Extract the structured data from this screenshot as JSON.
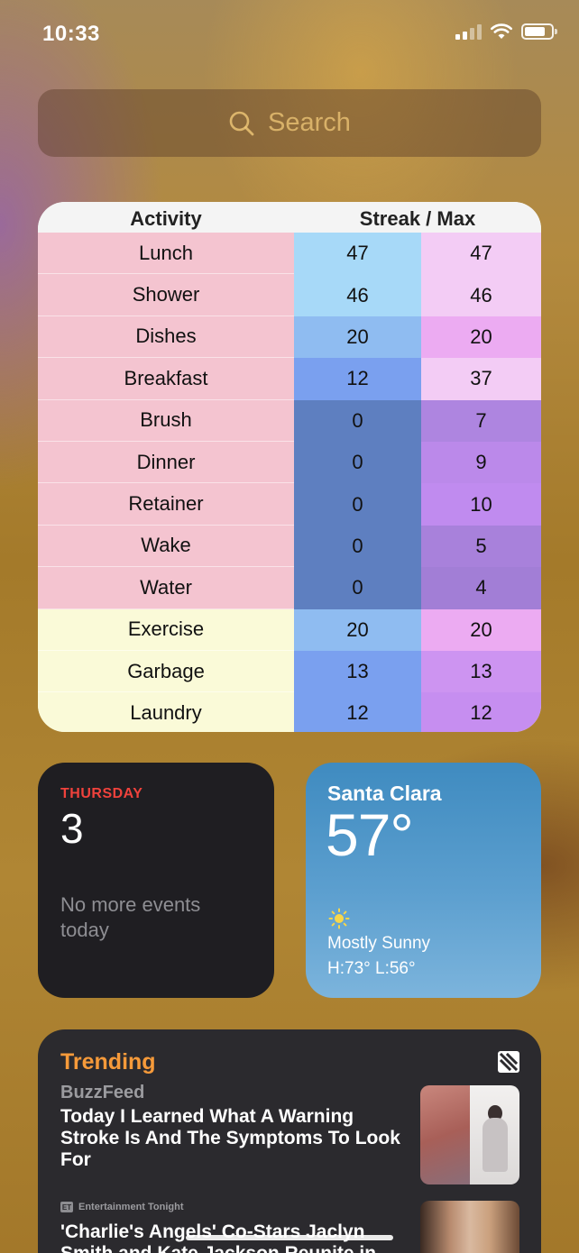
{
  "status_bar": {
    "time": "10:33"
  },
  "search": {
    "label": "Search"
  },
  "activity_widget": {
    "header_activity": "Activity",
    "header_streak_max": "Streak / Max",
    "rows": [
      {
        "activity": "Lunch",
        "streak": "47",
        "max": "47",
        "name_color": "#f4c4d0",
        "streak_color": "#a7d9f8",
        "max_color": "#f3ccf5"
      },
      {
        "activity": "Shower",
        "streak": "46",
        "max": "46",
        "name_color": "#f4c4d0",
        "streak_color": "#a7d9f8",
        "max_color": "#f3ccf5"
      },
      {
        "activity": "Dishes",
        "streak": "20",
        "max": "20",
        "name_color": "#f4c4d0",
        "streak_color": "#8fbcf1",
        "max_color": "#ecabf2"
      },
      {
        "activity": "Breakfast",
        "streak": "12",
        "max": "37",
        "name_color": "#f4c4d0",
        "streak_color": "#7aa0ef",
        "max_color": "#f3ccf5"
      },
      {
        "activity": "Brush",
        "streak": "0",
        "max": "7",
        "name_color": "#f4c4d0",
        "streak_color": "#5e7fc0",
        "max_color": "#ae85e0"
      },
      {
        "activity": "Dinner",
        "streak": "0",
        "max": "9",
        "name_color": "#f4c4d0",
        "streak_color": "#5e7fc0",
        "max_color": "#bb89ea"
      },
      {
        "activity": "Retainer",
        "streak": "0",
        "max": "10",
        "name_color": "#f4c4d0",
        "streak_color": "#5e7fc0",
        "max_color": "#c08bef"
      },
      {
        "activity": "Wake",
        "streak": "0",
        "max": "5",
        "name_color": "#f4c4d0",
        "streak_color": "#5e7fc0",
        "max_color": "#a881db"
      },
      {
        "activity": "Water",
        "streak": "0",
        "max": "4",
        "name_color": "#f4c4d0",
        "streak_color": "#5e7fc0",
        "max_color": "#a27ed6"
      },
      {
        "activity": "Exercise",
        "streak": "20",
        "max": "20",
        "name_color": "#fafad8",
        "streak_color": "#8fbcf1",
        "max_color": "#ecabf2"
      },
      {
        "activity": "Garbage",
        "streak": "13",
        "max": "13",
        "name_color": "#fafad8",
        "streak_color": "#7aa0ef",
        "max_color": "#cd94f1"
      },
      {
        "activity": "Laundry",
        "streak": "12",
        "max": "12",
        "name_color": "#fafad8",
        "streak_color": "#7aa0ef",
        "max_color": "#c68ef0"
      }
    ]
  },
  "calendar_widget": {
    "day": "THURSDAY",
    "date": "3",
    "events": "No more events today"
  },
  "weather_widget": {
    "city": "Santa Clara",
    "temperature": "57°",
    "icon": "sun-icon",
    "condition": "Mostly Sunny",
    "hi_lo": "H:73° L:56°"
  },
  "news_widget": {
    "title": "Trending",
    "icon": "news-logo-icon",
    "story1": {
      "source": "BuzzFeed",
      "headline": "Today I Learned What A Warning Stroke Is And The Symptoms To Look For"
    },
    "story2": {
      "source": "Entertainment Tonight",
      "source_badge": "ET",
      "headline": "'Charlie's Angels' Co-Stars Jaclyn Smith and Kate Jackson Reunite in"
    }
  },
  "colors": {
    "accent_red": "#f0423c",
    "trending_orange": "#f69a3a"
  }
}
